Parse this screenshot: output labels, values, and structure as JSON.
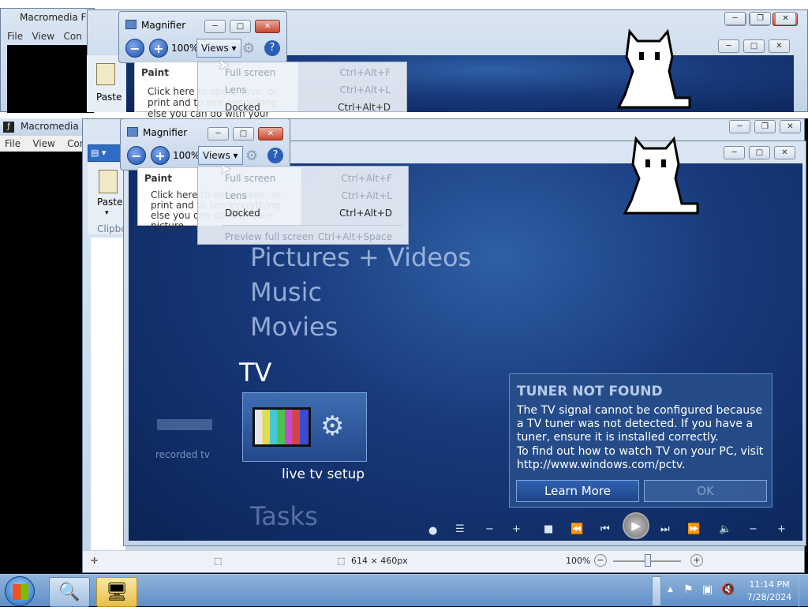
{
  "macromedia": {
    "title": "Macromedia F",
    "menu": [
      "File",
      "View",
      "Con"
    ]
  },
  "magnifier": {
    "title": "Magnifier",
    "zoom": "100%",
    "views_label": "Views",
    "tooltip_title": "Paint",
    "tooltip_text": "Click here to open, save, or print and to see everything else you can do with your picture.",
    "views_menu_top": [
      {
        "label": "Full screen",
        "shortcut": "Ctrl+Alt+F"
      },
      {
        "label": "Lens",
        "shortcut": "Ctrl+Alt+L"
      },
      {
        "label": "Docked",
        "shortcut": "Ctrl+Alt+D"
      }
    ],
    "views_menu": [
      {
        "label": "Full screen",
        "shortcut": "Ctrl+Alt+F"
      },
      {
        "label": "Lens",
        "shortcut": "Ctrl+Alt+L"
      },
      {
        "label": "Docked",
        "shortcut": "Ctrl+Alt+D"
      },
      {
        "label": "Preview full screen",
        "shortcut": "Ctrl+Alt+Space"
      }
    ]
  },
  "paint": {
    "paste_label": "Paste",
    "clipboard_label": "Clipbo"
  },
  "media_center": {
    "menu": [
      "Pictures + Videos",
      "Music",
      "Movies",
      "TV",
      "Tasks"
    ],
    "recorded_tv": "recorded tv",
    "live_tv_setup": "live tv setup",
    "dialog": {
      "title": "TUNER NOT FOUND",
      "text1": "The TV signal cannot be configured because a TV tuner was not detected. If you have a tuner, ensure it is installed correctly.",
      "text2": "To find out how to watch TV on your PC, visit http://www.windows.com/pctv.",
      "learn_more": "Learn More",
      "ok": "OK"
    }
  },
  "status_bar": {
    "dimensions": "614 × 460px",
    "zoom": "100%"
  },
  "taskbar": {
    "time": "11:14 PM",
    "date": "7/28/2024"
  }
}
